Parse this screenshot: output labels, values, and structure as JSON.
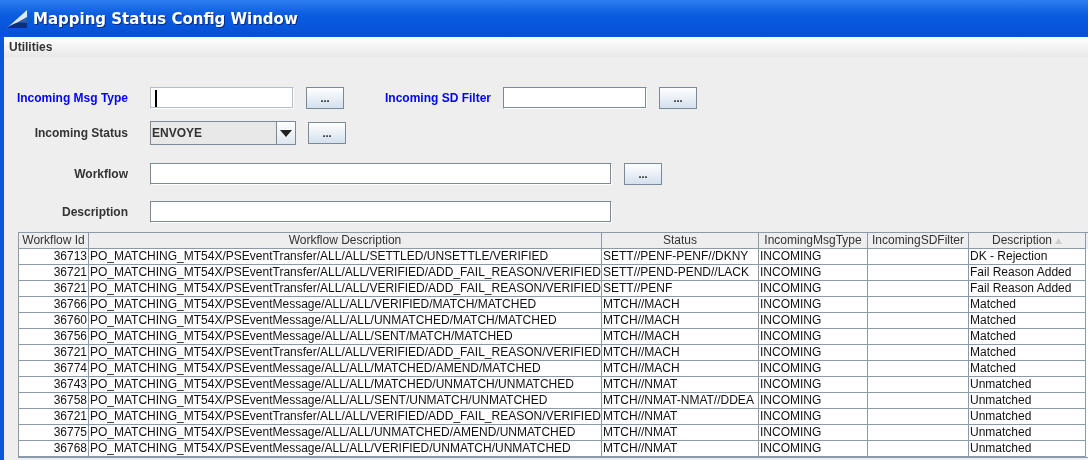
{
  "window": {
    "title": "Mapping Status Config Window"
  },
  "menu": [
    "Utilities"
  ],
  "form_rows": [
    {
      "fields": [
        {
          "kind": "text",
          "label": "Incoming Msg Type",
          "color": "#0000ff",
          "focused": true,
          "button": "..."
        },
        {
          "kind": "text",
          "label": "Incoming SD Filter",
          "color": "#0000ff",
          "focused": false,
          "button": "..."
        }
      ]
    },
    {
      "fields": [
        {
          "kind": "combo",
          "label": "Incoming Status",
          "color": "#333333",
          "value": "ENVOYE",
          "button": "..."
        }
      ]
    },
    {
      "fields": [
        {
          "kind": "wide",
          "label": "Workflow",
          "color": "#333333",
          "focused": false,
          "button": "..."
        }
      ]
    },
    {
      "fields": [
        {
          "kind": "wide",
          "label": "Description",
          "color": "#333333",
          "focused": false
        }
      ]
    }
  ],
  "table": {
    "columns": [
      {
        "label": "Workflow Id",
        "kind": "number"
      },
      {
        "label": "Workflow Description",
        "kind": "text"
      },
      {
        "label": "Status",
        "kind": "text"
      },
      {
        "label": "IncomingMsgType",
        "kind": "text"
      },
      {
        "label": "IncomingSDFilter",
        "kind": "text"
      },
      {
        "label": "Description",
        "kind": "text",
        "sorted": true
      }
    ],
    "rows": [
      [
        "36713",
        "PO_MATCHING_MT54X/PSEventTransfer/ALL/ALL/SETTLED/UNSETTLE/VERIFIED",
        "SETT//PENF-PENF//DKNY",
        "INCOMING",
        "",
        "DK - Rejection"
      ],
      [
        "36721",
        "PO_MATCHING_MT54X/PSEventTransfer/ALL/ALL/VERIFIED/ADD_FAIL_REASON/VERIFIED",
        "SETT//PEND-PEND//LACK",
        "INCOMING",
        "",
        "Fail Reason Added"
      ],
      [
        "36721",
        "PO_MATCHING_MT54X/PSEventTransfer/ALL/ALL/VERIFIED/ADD_FAIL_REASON/VERIFIED",
        "SETT//PENF",
        "INCOMING",
        "",
        "Fail Reason Added"
      ],
      [
        "36766",
        "PO_MATCHING_MT54X/PSEventMessage/ALL/ALL/VERIFIED/MATCH/MATCHED",
        "MTCH//MACH",
        "INCOMING",
        "",
        "Matched"
      ],
      [
        "36760",
        "PO_MATCHING_MT54X/PSEventMessage/ALL/ALL/UNMATCHED/MATCH/MATCHED",
        "MTCH//MACH",
        "INCOMING",
        "",
        "Matched"
      ],
      [
        "36756",
        "PO_MATCHING_MT54X/PSEventMessage/ALL/ALL/SENT/MATCH/MATCHED",
        "MTCH//MACH",
        "INCOMING",
        "",
        "Matched"
      ],
      [
        "36721",
        "PO_MATCHING_MT54X/PSEventTransfer/ALL/ALL/VERIFIED/ADD_FAIL_REASON/VERIFIED",
        "MTCH//MACH",
        "INCOMING",
        "",
        "Matched"
      ],
      [
        "36774",
        "PO_MATCHING_MT54X/PSEventMessage/ALL/ALL/MATCHED/AMEND/MATCHED",
        "MTCH//MACH",
        "INCOMING",
        "",
        "Matched"
      ],
      [
        "36743",
        "PO_MATCHING_MT54X/PSEventMessage/ALL/ALL/MATCHED/UNMATCH/UNMATCHED",
        "MTCH//NMAT",
        "INCOMING",
        "",
        "Unmatched"
      ],
      [
        "36758",
        "PO_MATCHING_MT54X/PSEventMessage/ALL/ALL/SENT/UNMATCH/UNMATCHED",
        "MTCH//NMAT-NMAT//DDEA",
        "INCOMING",
        "",
        "Unmatched"
      ],
      [
        "36721",
        "PO_MATCHING_MT54X/PSEventTransfer/ALL/ALL/VERIFIED/ADD_FAIL_REASON/VERIFIED",
        "MTCH//NMAT",
        "INCOMING",
        "",
        "Unmatched"
      ],
      [
        "36775",
        "PO_MATCHING_MT54X/PSEventMessage/ALL/ALL/UNMATCHED/AMEND/UNMATCHED",
        "MTCH//NMAT",
        "INCOMING",
        "",
        "Unmatched"
      ],
      [
        "36768",
        "PO_MATCHING_MT54X/PSEventMessage/ALL/ALL/VERIFIED/UNMATCH/UNMATCHED",
        "MTCH//NMAT",
        "INCOMING",
        "",
        "Unmatched"
      ]
    ]
  }
}
